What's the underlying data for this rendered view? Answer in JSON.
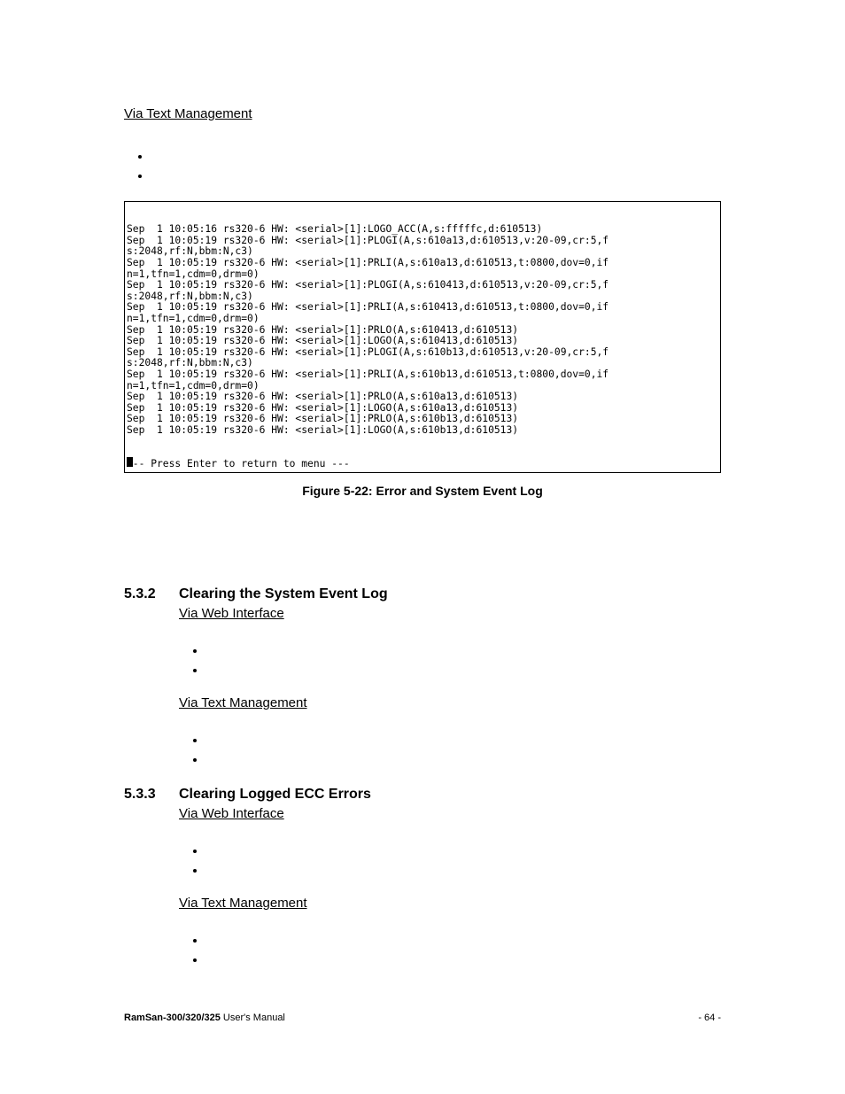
{
  "topSection": {
    "viaText": "Via Text Management",
    "logLines": [
      "Sep  1 10:05:16 rs320-6 HW: <serial>[1]:LOGO_ACC(A,s:fffffc,d:610513)",
      "Sep  1 10:05:19 rs320-6 HW: <serial>[1]:PLOGI(A,s:610a13,d:610513,v:20-09,cr:5,f",
      "s:2048,rf:N,bbm:N,c3)",
      "Sep  1 10:05:19 rs320-6 HW: <serial>[1]:PRLI(A,s:610a13,d:610513,t:0800,dov=0,if",
      "n=1,tfn=1,cdm=0,drm=0)",
      "Sep  1 10:05:19 rs320-6 HW: <serial>[1]:PLOGI(A,s:610413,d:610513,v:20-09,cr:5,f",
      "s:2048,rf:N,bbm:N,c3)",
      "Sep  1 10:05:19 rs320-6 HW: <serial>[1]:PRLI(A,s:610413,d:610513,t:0800,dov=0,if",
      "n=1,tfn=1,cdm=0,drm=0)",
      "Sep  1 10:05:19 rs320-6 HW: <serial>[1]:PRLO(A,s:610413,d:610513)",
      "Sep  1 10:05:19 rs320-6 HW: <serial>[1]:LOGO(A,s:610413,d:610513)",
      "Sep  1 10:05:19 rs320-6 HW: <serial>[1]:PLOGI(A,s:610b13,d:610513,v:20-09,cr:5,f",
      "s:2048,rf:N,bbm:N,c3)",
      "Sep  1 10:05:19 rs320-6 HW: <serial>[1]:PRLI(A,s:610b13,d:610513,t:0800,dov=0,if",
      "n=1,tfn=1,cdm=0,drm=0)",
      "Sep  1 10:05:19 rs320-6 HW: <serial>[1]:PRLO(A,s:610a13,d:610513)",
      "Sep  1 10:05:19 rs320-6 HW: <serial>[1]:LOGO(A,s:610a13,d:610513)",
      "Sep  1 10:05:19 rs320-6 HW: <serial>[1]:PRLO(A,s:610b13,d:610513)",
      "Sep  1 10:05:19 rs320-6 HW: <serial>[1]:LOGO(A,s:610b13,d:610513)",
      "",
      "",
      "--- Press Enter to return to menu ---",
      ""
    ],
    "figureCaption": "Figure 5-22: Error and System Event Log"
  },
  "sections": [
    {
      "num": "5.3.2",
      "title": "Clearing the System Event Log",
      "viaWeb": "Via Web Interface",
      "viaText": "Via Text Management"
    },
    {
      "num": "5.3.3",
      "title": "Clearing Logged ECC Errors",
      "viaWeb": "Via Web Interface",
      "viaText": "Via Text Management"
    }
  ],
  "footer": {
    "leftBold": "RamSan-300/320/325",
    "leftRest": " User's Manual",
    "right": "- 64 -"
  }
}
